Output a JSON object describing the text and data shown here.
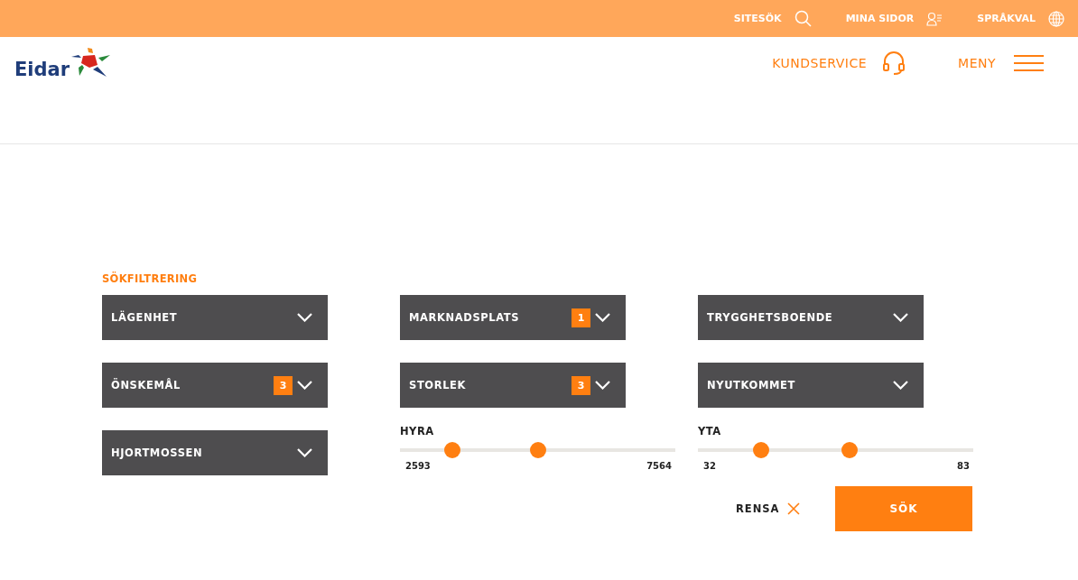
{
  "top_bar": {
    "links": [
      {
        "label": "SITESÖK",
        "kind": "search"
      },
      {
        "label": "MINA SIDOR",
        "kind": "user"
      },
      {
        "label": "SPRÅKVAL",
        "kind": "globe"
      }
    ]
  },
  "header": {
    "logo": "Eidar",
    "customer_service": "KUNDSERVICE",
    "menu": "MENY"
  },
  "filters": {
    "title": "SÖKFILTRERING",
    "columns": [
      {
        "items": [
          {
            "kind": "dropdown",
            "label": "LÄGENHET"
          },
          {
            "kind": "dropdown",
            "label": "ÖNSKEMÅL",
            "count": "3"
          },
          {
            "kind": "dropdown",
            "label": "HJORTMOSSEN"
          }
        ]
      },
      {
        "items": [
          {
            "kind": "dropdown",
            "label": "MARKNADSPLATS",
            "count": "1"
          },
          {
            "kind": "dropdown",
            "label": "STORLEK",
            "count": "3"
          },
          {
            "kind": "slider",
            "label": "HYRA",
            "min": "2593",
            "max": "7564",
            "thumbs": [
              {
                "level": 0.19
              },
              {
                "level": 0.5
              }
            ]
          }
        ]
      },
      {
        "items": [
          {
            "kind": "dropdown",
            "label": "TRYGGHETSBOENDE"
          },
          {
            "kind": "dropdown",
            "label": "NYUTKOMMET"
          },
          {
            "kind": "slider",
            "label": "YTA",
            "min": "32",
            "max": "83",
            "thumbs": [
              {
                "level": 0.23
              },
              {
                "level": 0.55
              }
            ]
          }
        ]
      }
    ],
    "clear": "RENSA",
    "search": "SÖK"
  }
}
